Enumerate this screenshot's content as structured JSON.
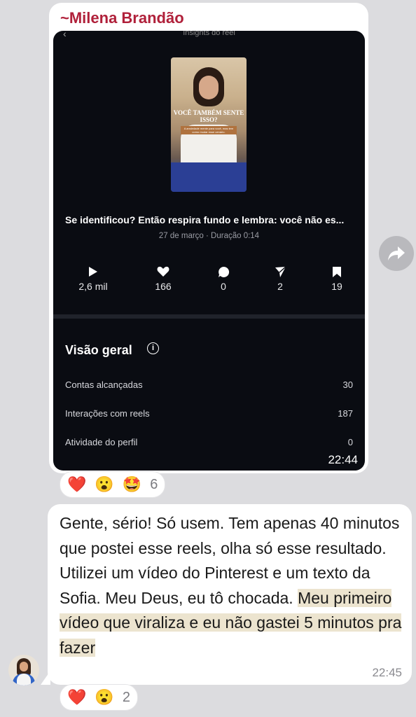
{
  "message1": {
    "sender": "~Milena Brandão",
    "time": "22:44",
    "screenshot": {
      "topbar": {
        "back_icon": "chevron-left-icon",
        "title": "Insights do reel"
      },
      "thumbnail": {
        "headline": "VOCÊ TAMBÉM SENTE ISSO?",
        "subline": "A ansiedade mente para você, mas tem como mudar esse cenário."
      },
      "caption": "Se identificou? Então respira fundo e lembra: você não es...",
      "meta": "27 de março · Duração 0:14",
      "stats": [
        {
          "icon": "play-icon",
          "value": "2,6 mil"
        },
        {
          "icon": "heart-icon",
          "value": "166"
        },
        {
          "icon": "comment-icon",
          "value": "0"
        },
        {
          "icon": "send-icon",
          "value": "2"
        },
        {
          "icon": "bookmark-icon",
          "value": "19"
        }
      ],
      "overview": {
        "title": "Visão geral",
        "info_icon": "i",
        "rows": [
          {
            "label": "Contas alcançadas",
            "value": "30"
          },
          {
            "label": "Interações com reels",
            "value": "187"
          },
          {
            "label": "Atividade do perfil",
            "value": "0"
          }
        ]
      }
    },
    "reactions": {
      "emojis": [
        "❤️",
        "😮",
        "🤩"
      ],
      "count": "6"
    }
  },
  "message2": {
    "text_plain": "Gente, sério! Só usem. Tem apenas 40 minutos que postei esse reels, olha só esse resultado. Utilizei um vídeo do Pinterest e um texto da Sofia. Meu Deus, eu tô chocada. ",
    "text_highlight": "Meu primeiro vídeo que viraliza e eu não gastei 5 minutos pra fazer",
    "time": "22:45",
    "reactions": {
      "emojis": [
        "❤️",
        "😮"
      ],
      "count": "2"
    }
  },
  "colors": {
    "sender": "#b0203a",
    "highlight": "#ece4cf",
    "background": "#dcdcdf"
  }
}
